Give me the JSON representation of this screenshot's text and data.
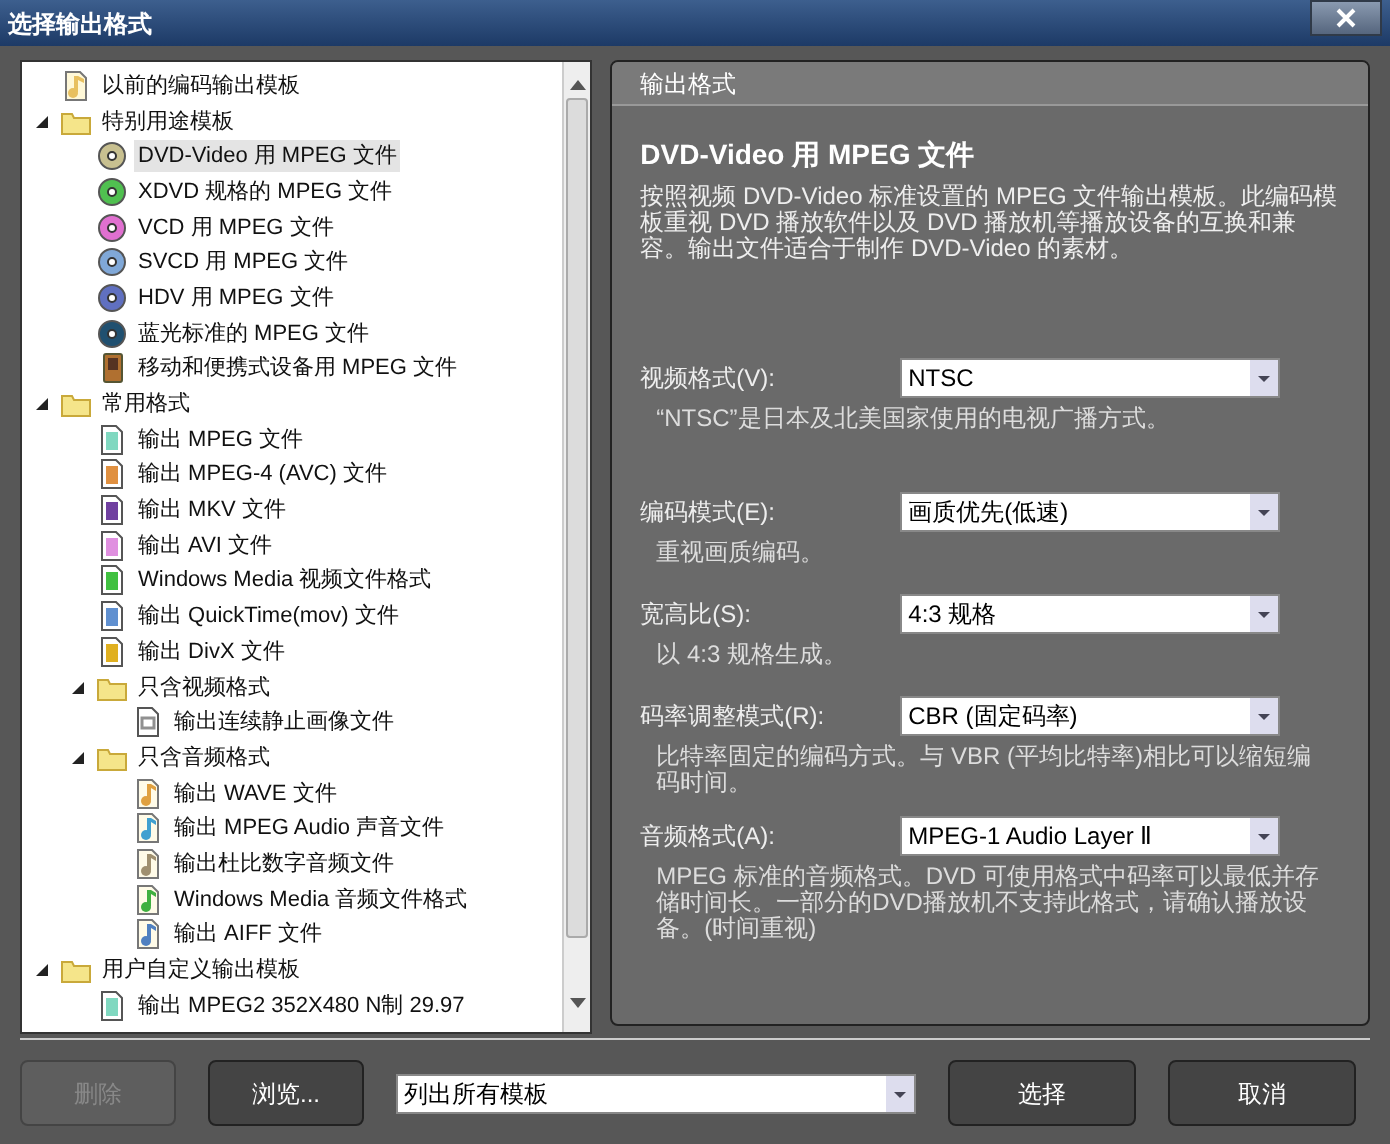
{
  "window": {
    "title": "选择输出格式"
  },
  "tree": [
    {
      "label": "以前的编码输出模板",
      "kind": "template",
      "color": "#e8c060",
      "selected": false
    },
    {
      "label": "特别用途模板",
      "kind": "folder",
      "expanded": true,
      "selected": false,
      "children": [
        {
          "label": "DVD-Video 用 MPEG 文件",
          "kind": "disc",
          "color": "#c8c090",
          "selected": true
        },
        {
          "label": "XDVD 规格的 MPEG 文件",
          "kind": "disc",
          "color": "#50c050",
          "selected": false
        },
        {
          "label": "VCD 用 MPEG 文件",
          "kind": "disc",
          "color": "#e070d0",
          "selected": false
        },
        {
          "label": "SVCD 用 MPEG 文件",
          "kind": "disc",
          "color": "#80a8d8",
          "selected": false
        },
        {
          "label": "HDV 用 MPEG 文件",
          "kind": "disc",
          "color": "#6070c0",
          "selected": false
        },
        {
          "label": "蓝光标准的 MPEG 文件",
          "kind": "disc",
          "color": "#205070",
          "selected": false
        },
        {
          "label": "移动和便携式设备用 MPEG 文件",
          "kind": "device",
          "color": "#b07030",
          "selected": false
        }
      ]
    },
    {
      "label": "常用格式",
      "kind": "folder",
      "expanded": true,
      "selected": false,
      "children": [
        {
          "label": "输出 MPEG 文件",
          "kind": "file",
          "color": "#80d8c0",
          "selected": false
        },
        {
          "label": "输出 MPEG-4 (AVC) 文件",
          "kind": "file",
          "color": "#e09040",
          "selected": false
        },
        {
          "label": "输出 MKV 文件",
          "kind": "file",
          "color": "#7040a0",
          "selected": false
        },
        {
          "label": "输出 AVI 文件",
          "kind": "file",
          "color": "#e090e0",
          "selected": false
        },
        {
          "label": "Windows Media 视频文件格式",
          "kind": "file",
          "color": "#40c040",
          "selected": false
        },
        {
          "label": "输出 QuickTime(mov) 文件",
          "kind": "file",
          "color": "#6090d0",
          "selected": false
        },
        {
          "label": "输出 DivX 文件",
          "kind": "file",
          "color": "#e0b020",
          "selected": false
        },
        {
          "label": "只含视频格式",
          "kind": "folder",
          "expanded": true,
          "selected": false,
          "children": [
            {
              "label": "输出连续静止画像文件",
              "kind": "image",
              "color": "#909090",
              "selected": false
            }
          ]
        },
        {
          "label": "只含音频格式",
          "kind": "folder",
          "expanded": true,
          "selected": false,
          "children": [
            {
              "label": "输出 WAVE 文件",
              "kind": "audio",
              "color": "#e0a040",
              "selected": false
            },
            {
              "label": "输出 MPEG Audio 声音文件",
              "kind": "audio",
              "color": "#40a0d0",
              "selected": false
            },
            {
              "label": "输出杜比数字音频文件",
              "kind": "audio",
              "color": "#a09070",
              "selected": false
            },
            {
              "label": "Windows Media 音频文件格式",
              "kind": "audio",
              "color": "#40b040",
              "selected": false
            },
            {
              "label": "输出 AIFF 文件",
              "kind": "audio",
              "color": "#5080c0",
              "selected": false
            }
          ]
        }
      ]
    },
    {
      "label": "用户自定义输出模板",
      "kind": "folder",
      "expanded": true,
      "selected": false,
      "children": [
        {
          "label": "输出 MPEG2 352X480 N制 29.97",
          "kind": "file",
          "color": "#80d8c0",
          "selected": false
        }
      ]
    }
  ],
  "panel": {
    "header": "输出格式",
    "heading": "DVD-Video 用 MPEG 文件",
    "description": "按照视频 DVD-Video 标准设置的 MPEG 文件输出模板。此编码模板重视 DVD 播放软件以及 DVD 播放机等播放设备的互换和兼容。输出文件适合于制作 DVD-Video 的素材。",
    "settings": [
      {
        "label": "视频格式(V):",
        "value": "NTSC",
        "note": "“NTSC”是日本及北美国家使用的电视广播方式。"
      },
      {
        "label": "编码模式(E):",
        "value": "画质优先(低速)",
        "note": "重视画质编码。"
      },
      {
        "label": "宽高比(S):",
        "value": "4:3 规格",
        "note": "以 4:3 规格生成。"
      },
      {
        "label": "码率调整模式(R):",
        "value": "CBR (固定码率)",
        "note": "比特率固定的编码方式。与 VBR (平均比特率)相比可以缩短编码时间。"
      },
      {
        "label": "音频格式(A):",
        "value": "MPEG-1 Audio Layer Ⅱ",
        "note": "MPEG 标准的音频格式。DVD 可使用格式中码率可以最低并存储时间长。一部分的DVD播放机不支持此格式，请确认播放设备。(时间重视)"
      }
    ]
  },
  "footer": {
    "delete_button": {
      "label": "删除",
      "disabled": true
    },
    "browse_button": {
      "label": "浏览...",
      "disabled": false
    },
    "filter": {
      "value": "列出所有模板"
    },
    "select_button": "选择",
    "cancel_button": "取消"
  }
}
